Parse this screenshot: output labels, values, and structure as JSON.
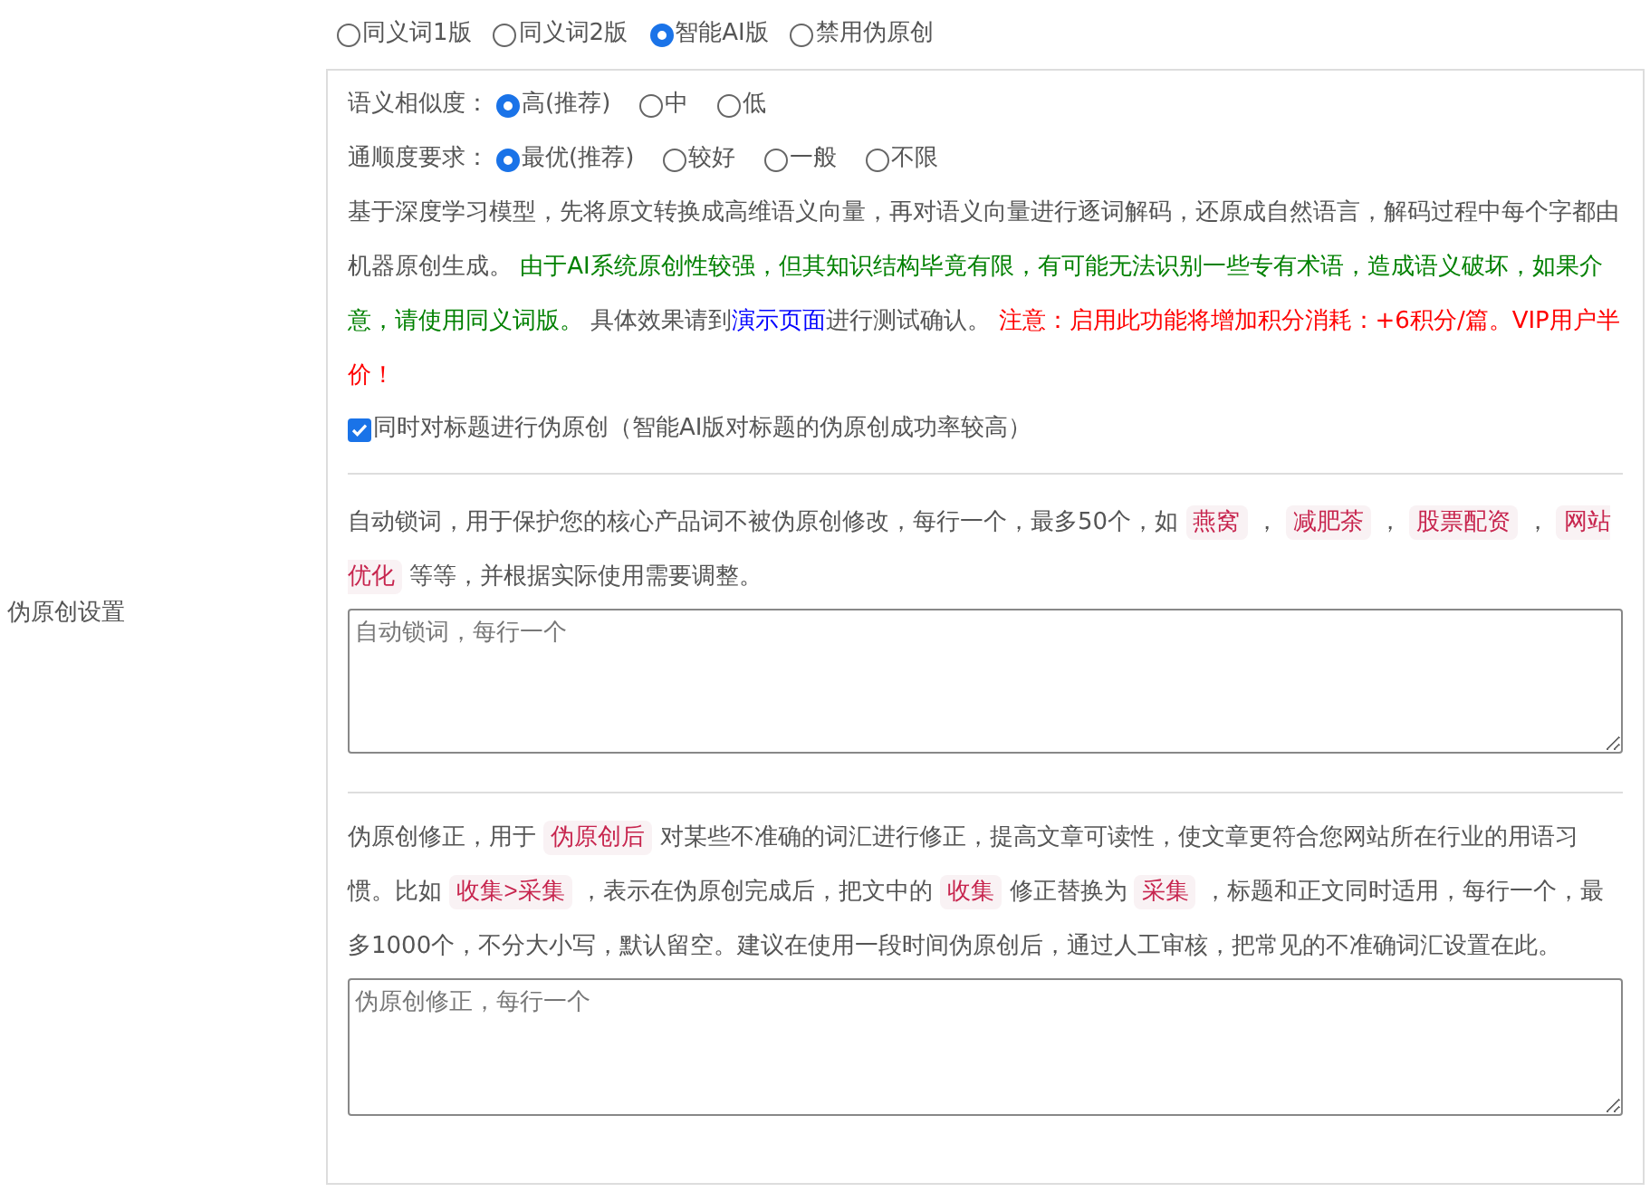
{
  "mode_options": [
    {
      "label": "同义词1版",
      "selected": false
    },
    {
      "label": "同义词2版",
      "selected": false
    },
    {
      "label": "智能AI版",
      "selected": true
    },
    {
      "label": "禁用伪原创",
      "selected": false
    }
  ],
  "ai_panel": {
    "settings": [
      {
        "label": "语义相似度：",
        "options": [
          {
            "label": "高(推荐)",
            "selected": true
          },
          {
            "label": "中",
            "selected": false
          },
          {
            "label": "低",
            "selected": false
          }
        ]
      },
      {
        "label": "通顺度要求：",
        "options": [
          {
            "label": "最优(推荐)",
            "selected": true
          },
          {
            "label": "较好",
            "selected": false
          },
          {
            "label": "一般",
            "selected": false
          },
          {
            "label": "不限",
            "selected": false
          }
        ]
      }
    ],
    "description": [
      {
        "kind": "text",
        "text": "基于深度学习模型，先将原文转换成高维语义向量，再对语义向量进行逐词解码，还原成自然语言，解码过程中每个字都由机器原创生成。 "
      },
      {
        "kind": "green",
        "text": "由于AI系统原创性较强，但其知识结构毕竟有限，有可能无法识别一些专有术语，造成语义破坏，如果介意，请使用同义词版。"
      },
      {
        "kind": "text",
        "text": " 具体效果请到"
      },
      {
        "kind": "link",
        "text": "演示页面"
      },
      {
        "kind": "text",
        "text": "进行测试确认。 "
      },
      {
        "kind": "red",
        "text": "注意：启用此功能将增加积分消耗：+6积分/篇。VIP用户半价！"
      }
    ],
    "title_option": {
      "label": "同时对标题进行伪原创（智能AI版对标题的伪原创成功率较高）",
      "checked": true
    }
  },
  "side_label": "伪原创设置",
  "lock_words": {
    "description": [
      {
        "kind": "text",
        "text": "自动锁词，用于保护您的核心产品词不被伪原创修改，每行一个，最多50个，如 "
      },
      {
        "kind": "code",
        "text": "燕窝"
      },
      {
        "kind": "text",
        "text": " ， "
      },
      {
        "kind": "code",
        "text": "减肥茶"
      },
      {
        "kind": "text",
        "text": " ， "
      },
      {
        "kind": "code",
        "text": "股票配资"
      },
      {
        "kind": "text",
        "text": " ， "
      },
      {
        "kind": "code",
        "text": "网站优化"
      },
      {
        "kind": "text",
        "text": " 等等，并根据实际使用需要调整。"
      }
    ],
    "placeholder": "自动锁词，每行一个"
  },
  "corrections": {
    "description": [
      {
        "kind": "text",
        "text": "伪原创修正，用于 "
      },
      {
        "kind": "code",
        "text": "伪原创后"
      },
      {
        "kind": "text",
        "text": " 对某些不准确的词汇进行修正，提高文章可读性，使文章更符合您网站所在行业的用语习惯。比如 "
      },
      {
        "kind": "code",
        "text": "收集>采集"
      },
      {
        "kind": "text",
        "text": " ，表示在伪原创完成后，把文中的 "
      },
      {
        "kind": "code",
        "text": "收集"
      },
      {
        "kind": "text",
        "text": " 修正替换为 "
      },
      {
        "kind": "code",
        "text": "采集"
      },
      {
        "kind": "text",
        "text": " ，标题和正文同时适用，每行一个，最多1000个，不分大小写，默认留空。建议在使用一段时间伪原创后，通过人工审核，把常见的不准确词汇设置在此。"
      }
    ],
    "placeholder": "伪原创修正，每行一个"
  }
}
